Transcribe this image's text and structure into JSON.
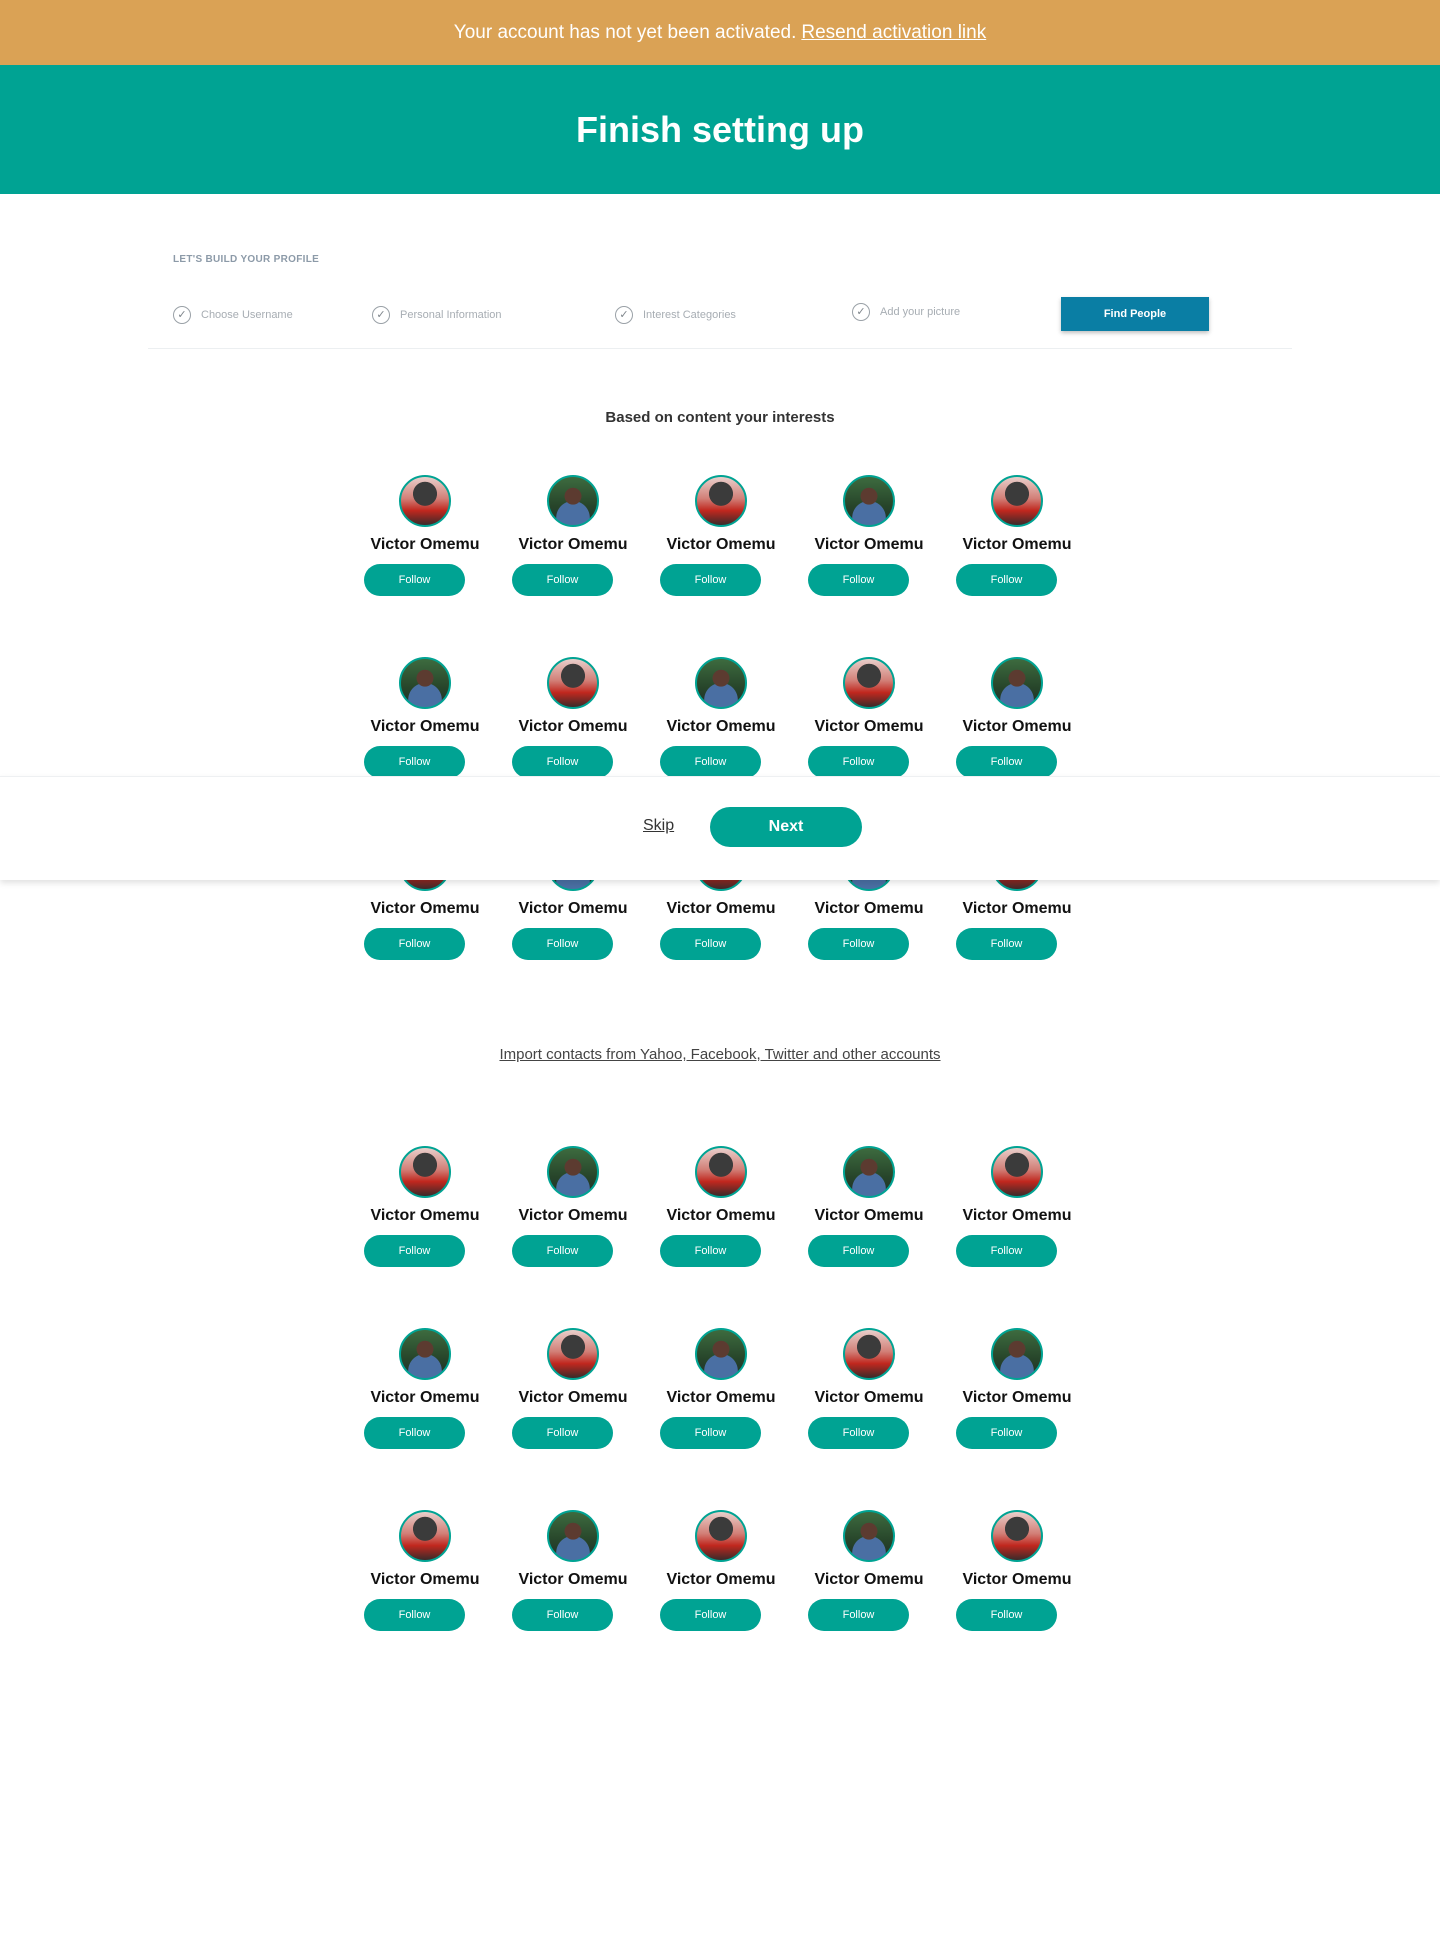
{
  "banner": {
    "message": "Your account has not yet been activated.",
    "link": "Resend activation link"
  },
  "hero": {
    "title": "Finish setting up"
  },
  "profile": {
    "label": "LET'S BUILD YOUR PROFILE",
    "steps": [
      {
        "label": "Choose Username",
        "icon": "check-circle-icon"
      },
      {
        "label": "Personal Information",
        "icon": "check-circle-icon"
      },
      {
        "label": "Interest Categories",
        "icon": "check-circle-icon"
      },
      {
        "label": "Add your picture",
        "icon": "check-circle-icon"
      }
    ],
    "active_step": "Find People"
  },
  "interests": {
    "title": "Based on content your interests"
  },
  "import": {
    "link": "Import contacts from Yahoo, Facebook, Twitter and other accounts"
  },
  "people_rows": [
    {
      "avatars": [
        "red",
        "green",
        "red",
        "green",
        "red"
      ]
    },
    {
      "avatars": [
        "green",
        "red",
        "green",
        "red",
        "green"
      ]
    },
    {
      "avatars": [
        "red",
        "green",
        "red",
        "green",
        "red"
      ]
    },
    {
      "avatars": [
        "red",
        "green",
        "red",
        "green",
        "red"
      ]
    },
    {
      "avatars": [
        "green",
        "red",
        "green",
        "red",
        "green"
      ]
    },
    {
      "avatars": [
        "red",
        "green",
        "red",
        "green",
        "red"
      ]
    }
  ],
  "person": {
    "name": "Victor Omemu",
    "follow_label": "Follow"
  },
  "actions": {
    "skip": "Skip",
    "next": "Next"
  },
  "colors": {
    "banner": "#daa255",
    "primary": "#00a393",
    "find_people": "#0a7ea4"
  }
}
